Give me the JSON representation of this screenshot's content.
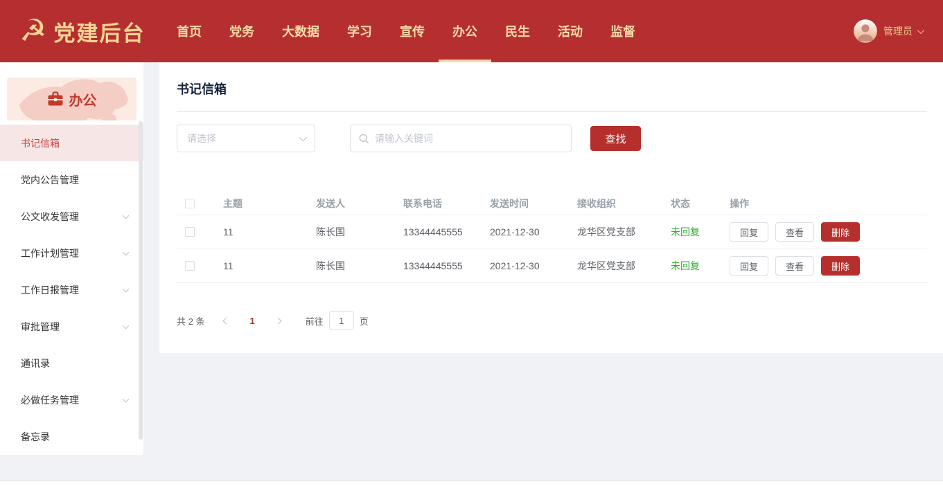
{
  "icons": {
    "party_emblem": "☭"
  },
  "colors": {
    "header_red": "#b52f31",
    "brand_red": "#b5302d",
    "gold": "#f5d492",
    "status_green": "#2eae2e",
    "active_item_bg": "#f7e6e6"
  },
  "header": {
    "logo_text": "党建后台",
    "nav": [
      {
        "label": "首页",
        "active": false
      },
      {
        "label": "党务",
        "active": false
      },
      {
        "label": "大数据",
        "active": false
      },
      {
        "label": "学习",
        "active": false
      },
      {
        "label": "宣传",
        "active": false
      },
      {
        "label": "办公",
        "active": true
      },
      {
        "label": "民生",
        "active": false
      },
      {
        "label": "活动",
        "active": false
      },
      {
        "label": "监督",
        "active": false
      }
    ],
    "user": {
      "name": "管理员"
    }
  },
  "sidebar": {
    "section_label": "办公",
    "items": [
      {
        "label": "书记信箱"
      },
      {
        "label": "党内公告管理"
      },
      {
        "label": "公文收发管理"
      },
      {
        "label": "工作计划管理"
      },
      {
        "label": "工作日报管理"
      },
      {
        "label": "审批管理"
      },
      {
        "label": "通讯录"
      },
      {
        "label": "必做任务管理"
      },
      {
        "label": "备忘录"
      }
    ]
  },
  "main": {
    "title": "书记信箱",
    "filters": {
      "select_placeholder": "请选择",
      "search_placeholder": "请输入关键词",
      "search_button": "查找"
    },
    "table": {
      "columns": [
        "主题",
        "发送人",
        "联系电话",
        "发送时间",
        "接收组织",
        "状态",
        "操作"
      ],
      "rows": [
        {
          "subject": "11",
          "sender": "陈长国",
          "phone": "13344445555",
          "time": "2021-12-30",
          "org": "龙华区党支部",
          "status": "未回复",
          "actions": [
            "回复",
            "查看",
            "删除"
          ]
        },
        {
          "subject": "11",
          "sender": "陈长国",
          "phone": "13344445555",
          "time": "2021-12-30",
          "org": "龙华区党支部",
          "status": "未回复",
          "actions": [
            "回复",
            "查看",
            "删除"
          ]
        }
      ]
    },
    "pagination": {
      "total": "共 2 条",
      "current_page": "1",
      "goto_label": "前往",
      "goto_value": "1",
      "page_unit": "页"
    }
  }
}
